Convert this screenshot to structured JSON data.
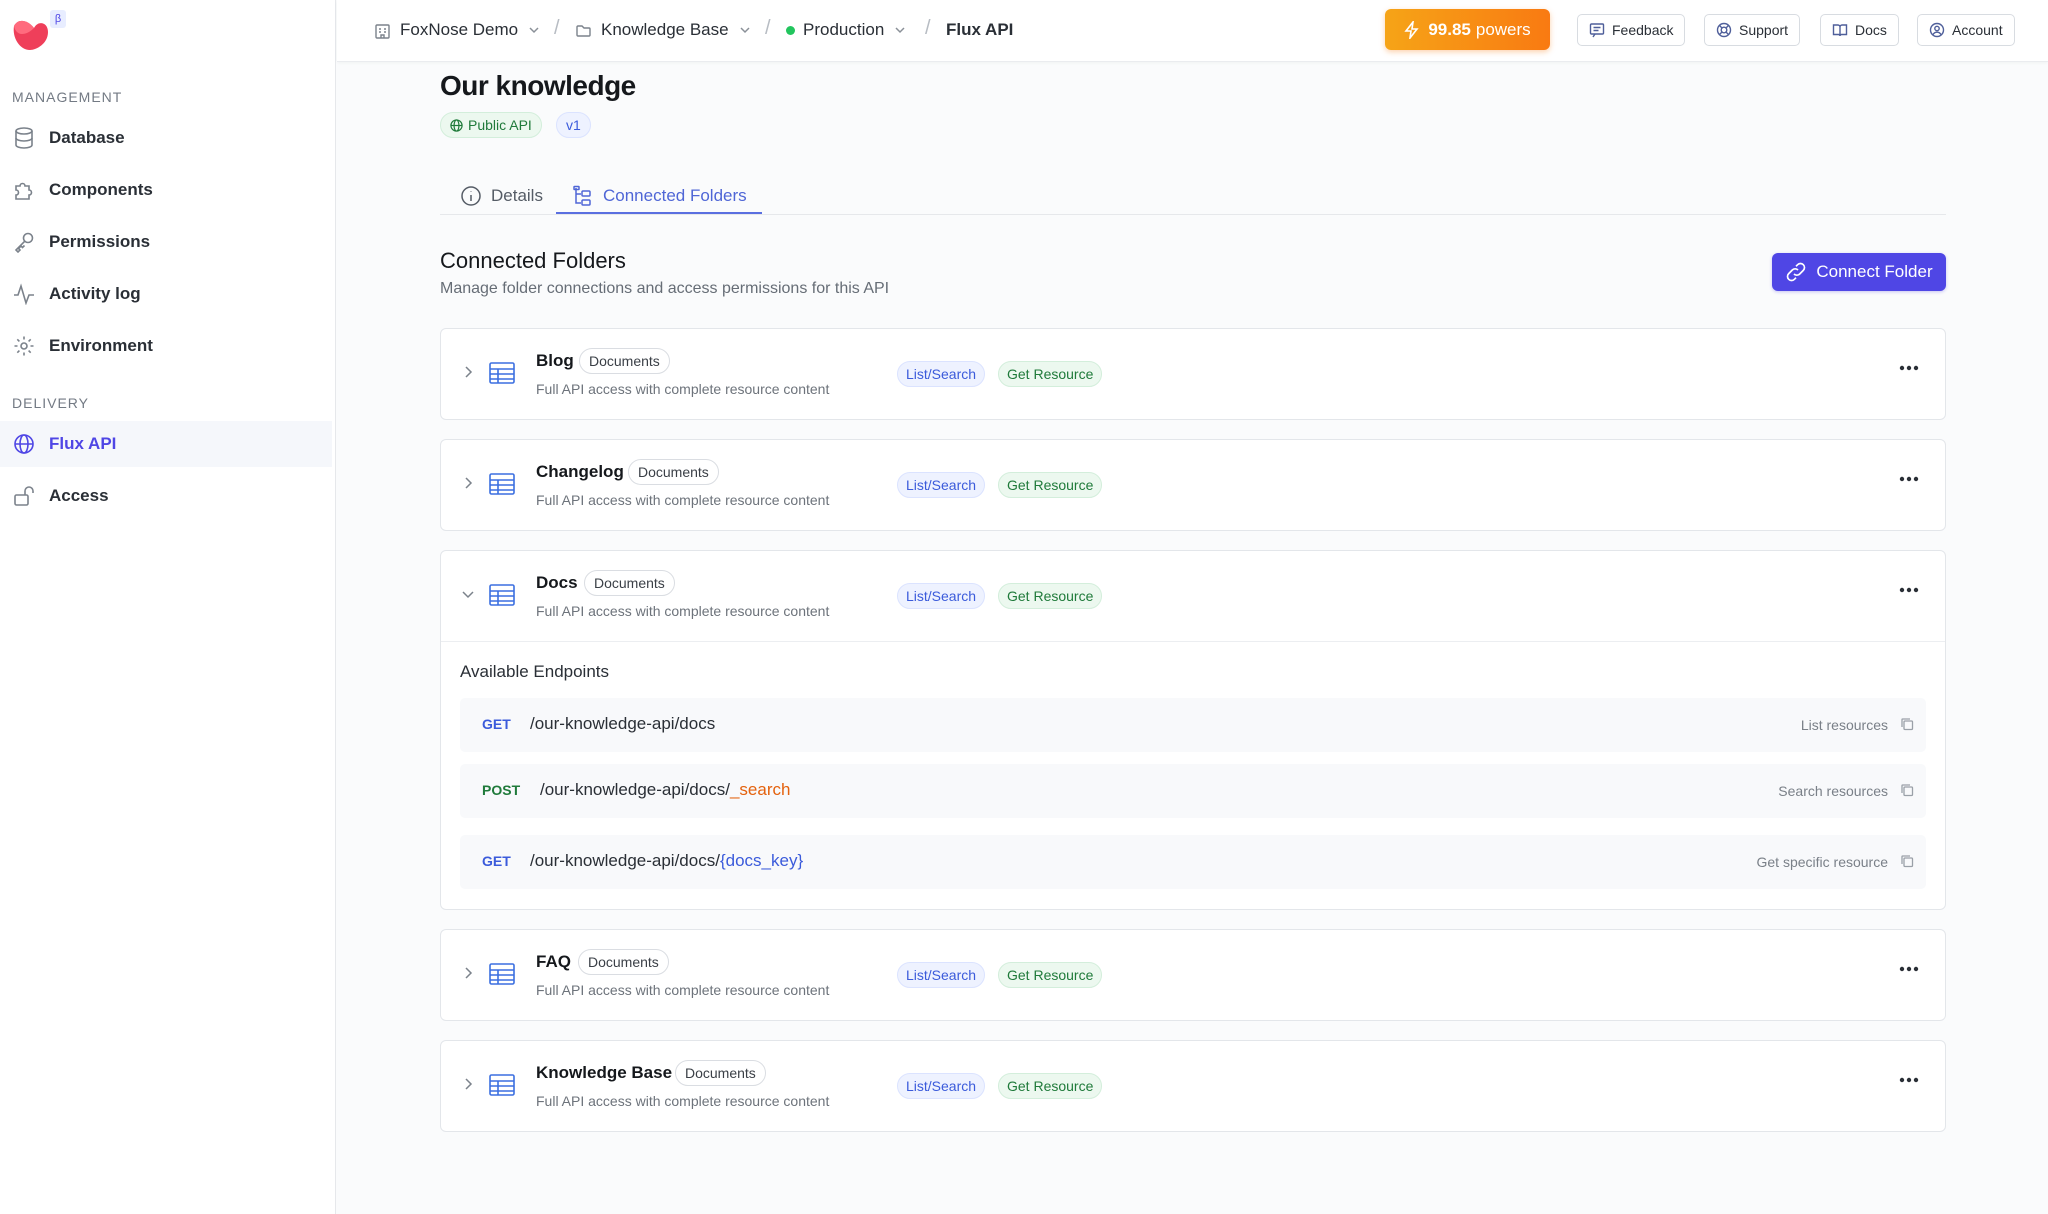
{
  "sidebar": {
    "beta": "β",
    "sections": {
      "management": "MANAGEMENT",
      "delivery": "DELIVERY"
    },
    "items": [
      {
        "id": "database",
        "label": "Database",
        "icon": "database-icon"
      },
      {
        "id": "components",
        "label": "Components",
        "icon": "puzzle-icon"
      },
      {
        "id": "permissions",
        "label": "Permissions",
        "icon": "key-icon"
      },
      {
        "id": "activity",
        "label": "Activity log",
        "icon": "activity-icon"
      },
      {
        "id": "environment",
        "label": "Environment",
        "icon": "gear-icon"
      },
      {
        "id": "flux",
        "label": "Flux API",
        "icon": "globe-icon",
        "active": true
      },
      {
        "id": "access",
        "label": "Access",
        "icon": "unlock-icon"
      }
    ]
  },
  "topbar": {
    "breadcrumbs": [
      {
        "label": "FoxNose Demo",
        "icon": "building-icon"
      },
      {
        "label": "Knowledge Base",
        "icon": "folder-icon"
      },
      {
        "label": "Production",
        "icon": "status-dot"
      },
      {
        "label": "Flux API"
      }
    ],
    "powers_value": "99.85",
    "powers_unit": "powers",
    "buttons": {
      "feedback": "Feedback",
      "support": "Support",
      "docs": "Docs",
      "account": "Account"
    }
  },
  "page": {
    "title": "Our knowledge",
    "badges": {
      "public": "Public API",
      "version": "v1"
    },
    "tabs": {
      "details": "Details",
      "folders": "Connected Folders"
    },
    "section_title": "Connected Folders",
    "section_subtitle": "Manage folder connections and access permissions for this API",
    "connect_button": "Connect Folder"
  },
  "folders": [
    {
      "name": "Blog",
      "type": "Documents",
      "desc": "Full API access with complete resource content",
      "perm_list": "List/Search",
      "perm_get": "Get Resource",
      "expanded": false
    },
    {
      "name": "Changelog",
      "type": "Documents",
      "desc": "Full API access with complete resource content",
      "perm_list": "List/Search",
      "perm_get": "Get Resource",
      "expanded": false
    },
    {
      "name": "Docs",
      "type": "Documents",
      "desc": "Full API access with complete resource content",
      "perm_list": "List/Search",
      "perm_get": "Get Resource",
      "expanded": true
    },
    {
      "name": "FAQ",
      "type": "Documents",
      "desc": "Full API access with complete resource content",
      "perm_list": "List/Search",
      "perm_get": "Get Resource",
      "expanded": false
    },
    {
      "name": "Knowledge Base",
      "type": "Documents",
      "desc": "Full API access with complete resource content",
      "perm_list": "List/Search",
      "perm_get": "Get Resource",
      "expanded": false
    }
  ],
  "endpoints": {
    "title": "Available Endpoints",
    "items": [
      {
        "method": "GET",
        "path": "/our-knowledge-api/docs",
        "suffix": "",
        "desc": "List resources"
      },
      {
        "method": "POST",
        "path": "/our-knowledge-api/docs/",
        "suffix": "_search",
        "desc": "Search resources"
      },
      {
        "method": "GET",
        "path": "/our-knowledge-api/docs/",
        "suffix": "{docs_key}",
        "desc": "Get specific resource"
      }
    ]
  }
}
